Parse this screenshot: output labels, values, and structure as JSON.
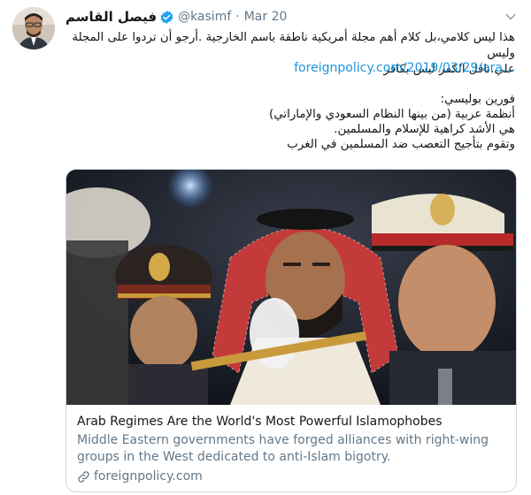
{
  "tweet": {
    "display_name": "فيصل القاسم",
    "handle": "@kasimf",
    "separator": "·",
    "date": "Mar 20",
    "text_line_1": "هذا ليس كلامي،بل كلام أهم مجلة أمريكية ناطقة باسم الخارجية .أرجو أن تردوا على المجلة وليس",
    "text_line_2": "علي.ناقل الكفر ليس بكافر",
    "link": "foreignpolicy.com/2019/03/29/ara…",
    "quote_lines": [
      "فورين بوليسي:",
      "أنظمة عربية (من بينها النظام السعودي والإماراتي)",
      "هي الأشد كراهية للإسلام والمسلمين.",
      "وتقوم بتأجيج التعصب ضد المسلمين في الغرب"
    ]
  },
  "card": {
    "title": "Arab Regimes Are the World's Most Powerful Islamophobes",
    "description": "Middle Eastern governments have forged alliances with right-wing groups in the West dedicated to anti-Islam bigotry.",
    "domain": "foreignpolicy.com"
  },
  "icons": {
    "verified": "verified-badge-icon",
    "caret": "chevron-down-icon",
    "link": "link-icon"
  },
  "colors": {
    "accent": "#1b95e0",
    "secondary_text": "#657786",
    "border": "#ccd6dd"
  }
}
